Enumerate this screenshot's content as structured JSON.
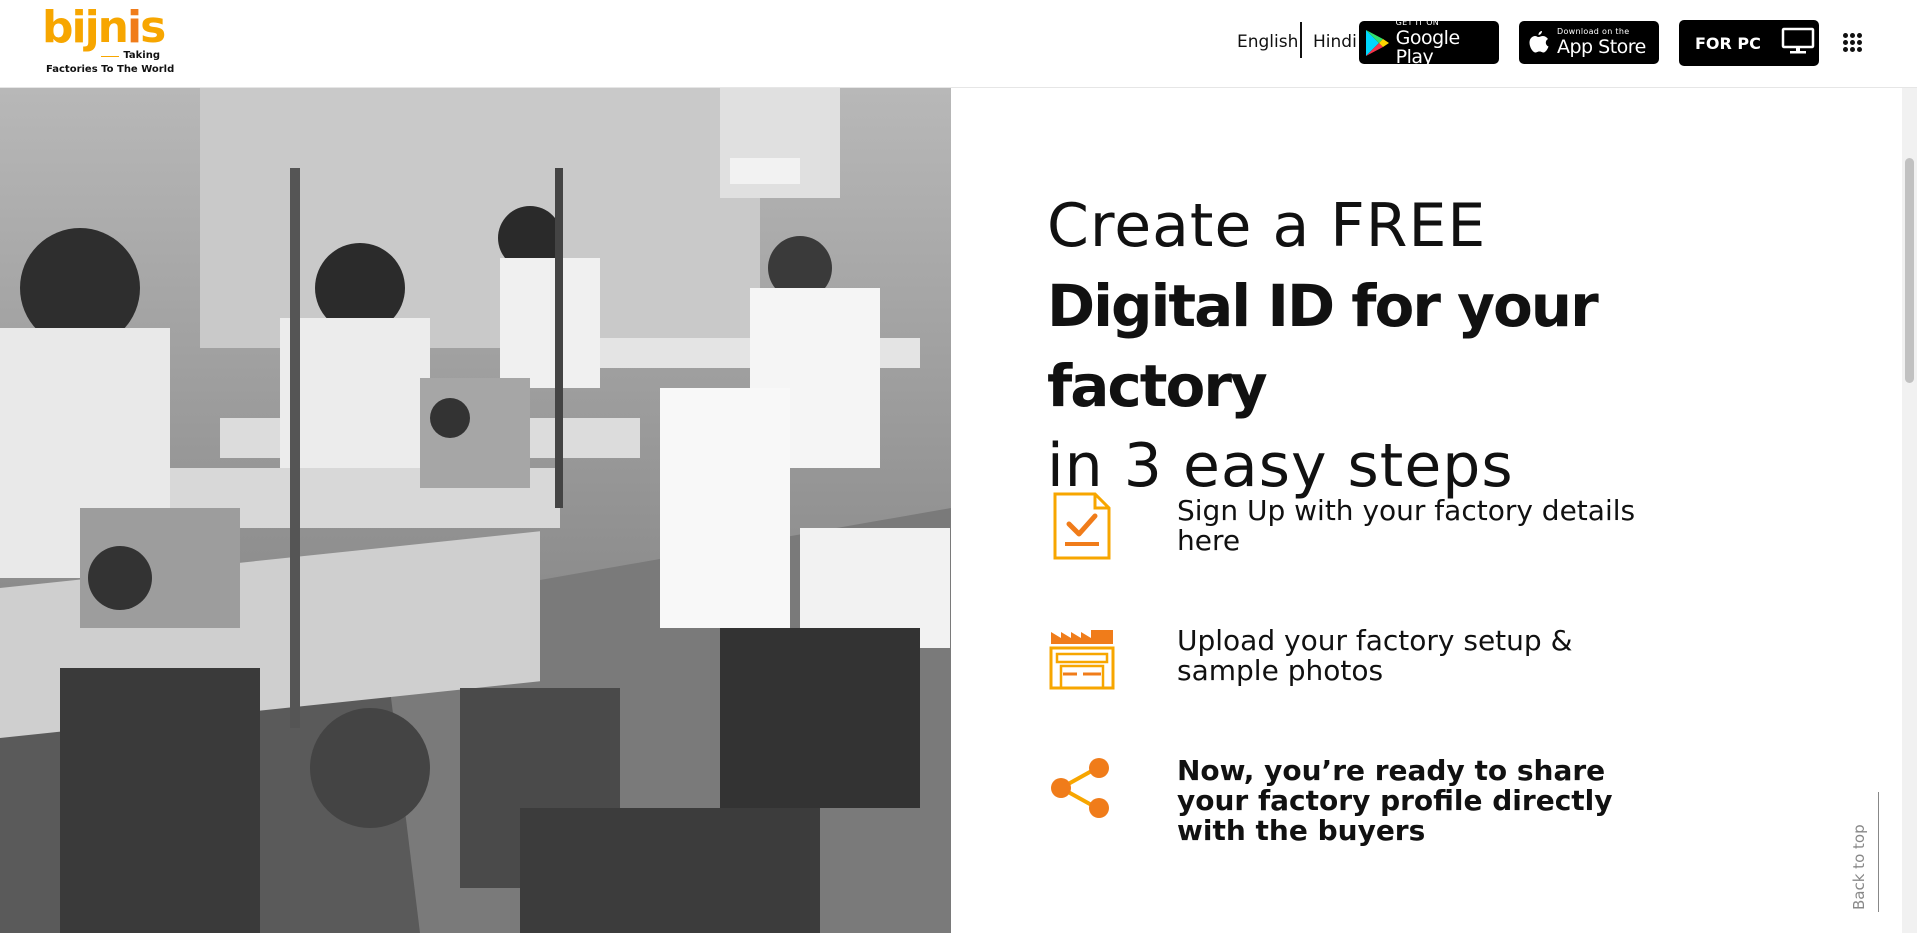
{
  "header": {
    "logo": {
      "wordmark": "bijnis",
      "tagline_1": "Taking",
      "tagline_2": "Factories To The World"
    },
    "languages": [
      "English",
      "Hindi"
    ],
    "google_play": {
      "small": "GET IT ON",
      "big": "Google Play"
    },
    "app_store": {
      "small": "Download on the",
      "big": "App Store"
    },
    "for_pc": {
      "label": "FOR PC"
    }
  },
  "hero": {
    "title_line1": "Create a FREE",
    "title_line2": "Digital ID for your factory",
    "title_line3": "in 3 easy steps",
    "image_alt": "Workers at sewing machines in a garment factory"
  },
  "steps": [
    {
      "icon": "checklist-icon",
      "text": "Sign Up with your factory details here"
    },
    {
      "icon": "factory-icon",
      "text": "Upload your factory setup & sample photos"
    },
    {
      "icon": "share-icon",
      "text": "Now, you’re ready to share your factory profile directly with the buyers"
    }
  ],
  "back_to_top": "Back to top",
  "colors": {
    "accent": "#f07c1a",
    "brand_yellow": "#f7a600",
    "text": "#111111"
  }
}
